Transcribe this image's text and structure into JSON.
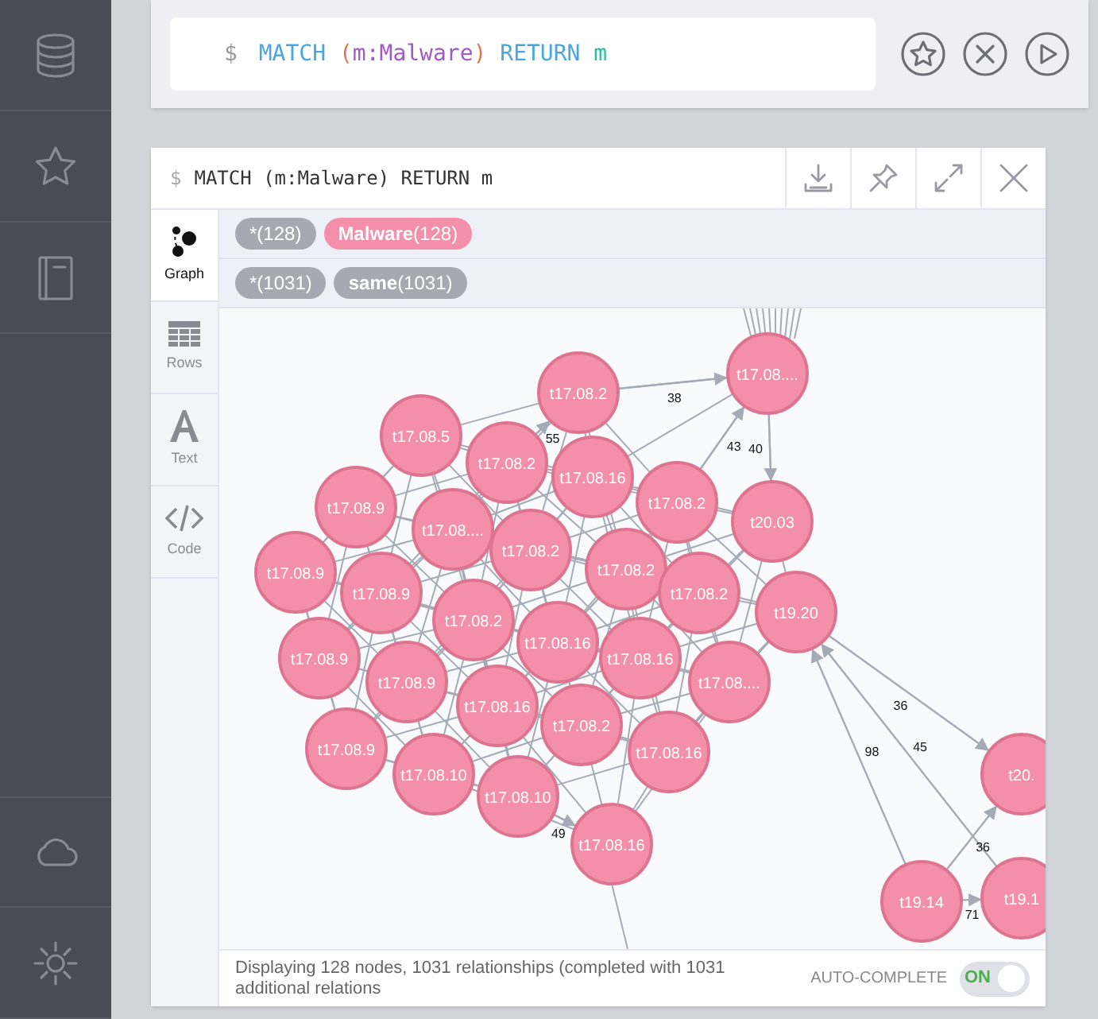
{
  "sidebar": {
    "items": [
      {
        "kind": "database"
      },
      {
        "kind": "star"
      },
      {
        "kind": "book"
      },
      {
        "kind": "cloud"
      },
      {
        "kind": "settings"
      }
    ]
  },
  "editor": {
    "tokens": [
      {
        "kind": "prompt",
        "text": "$"
      },
      {
        "kind": "keyword",
        "text": "MATCH"
      },
      {
        "kind": "paren",
        "text": "("
      },
      {
        "kind": "label",
        "text": "m:Malware"
      },
      {
        "kind": "paren",
        "text": ")"
      },
      {
        "kind": "keyword",
        "text": "RETURN"
      },
      {
        "kind": "variable",
        "text": "m"
      }
    ],
    "buttons": [
      {
        "kind": "favorite"
      },
      {
        "kind": "clear"
      },
      {
        "kind": "run"
      }
    ]
  },
  "result": {
    "prompt": "$",
    "query": "MATCH (m:Malware) RETURN m",
    "actions": [
      {
        "kind": "download"
      },
      {
        "kind": "pin"
      },
      {
        "kind": "expand"
      },
      {
        "kind": "close"
      }
    ],
    "tabs": [
      {
        "kind": "graph",
        "label": "Graph",
        "selected": true
      },
      {
        "kind": "rows",
        "label": "Rows",
        "selected": false
      },
      {
        "kind": "text",
        "label": "Text",
        "selected": false
      },
      {
        "kind": "code",
        "label": "Code",
        "selected": false
      }
    ],
    "node_labels": [
      {
        "text": "*(128)",
        "color": "#a5a9b1"
      },
      {
        "text": "**Malware**(128)",
        "color": "#f48fa9"
      }
    ],
    "relationship_types": [
      {
        "text": "*(1031)",
        "color": "#a5a9b1"
      },
      {
        "text": "**same**(1031)",
        "color": "#a5a9b1"
      }
    ],
    "nodes": [
      {
        "label": "t17.08...."
      },
      {
        "label": "t17.08.2"
      },
      {
        "label": "t17.08.5"
      },
      {
        "label": "t17.08.2"
      },
      {
        "label": "t17.08.16"
      },
      {
        "label": "t17.08.2"
      },
      {
        "label": "t17.08.9"
      },
      {
        "label": "t17.08...."
      },
      {
        "label": "t17.08.2"
      },
      {
        "label": "t20.03"
      },
      {
        "label": "t17.08.9"
      },
      {
        "label": "t17.08.9"
      },
      {
        "label": "t17.08.2"
      },
      {
        "label": "t17.08.2"
      },
      {
        "label": "t19.20"
      },
      {
        "label": "t17.08.2"
      },
      {
        "label": "t17.08.16"
      },
      {
        "label": "t17.08.9"
      },
      {
        "label": "t17.08.16"
      },
      {
        "label": "t17.08...."
      },
      {
        "label": "t17.08.9"
      },
      {
        "label": "t17.08.16"
      },
      {
        "label": "t17.08.2"
      },
      {
        "label": "t17.08.9"
      },
      {
        "label": "t17.08.16"
      },
      {
        "label": "t17.08.10"
      },
      {
        "label": "t17.08.10"
      },
      {
        "label": "t17.08.16"
      },
      {
        "label": "t20."
      },
      {
        "label": "t19.14"
      },
      {
        "label": "t19.1"
      }
    ],
    "relationships": [
      {
        "label": "38"
      },
      {
        "label": "43"
      },
      {
        "label": "40"
      },
      {
        "label": "55"
      },
      {
        "label": "36"
      },
      {
        "label": "98"
      },
      {
        "label": "45"
      },
      {
        "label": "36"
      },
      {
        "label": "71"
      },
      {
        "label": "49"
      }
    ],
    "status": "Displaying 128 nodes, 1031 relationships (completed with 1031 additional relations",
    "autocomplete": {
      "label": "AUTO-COMPLETE",
      "state": "ON",
      "on": true
    }
  }
}
